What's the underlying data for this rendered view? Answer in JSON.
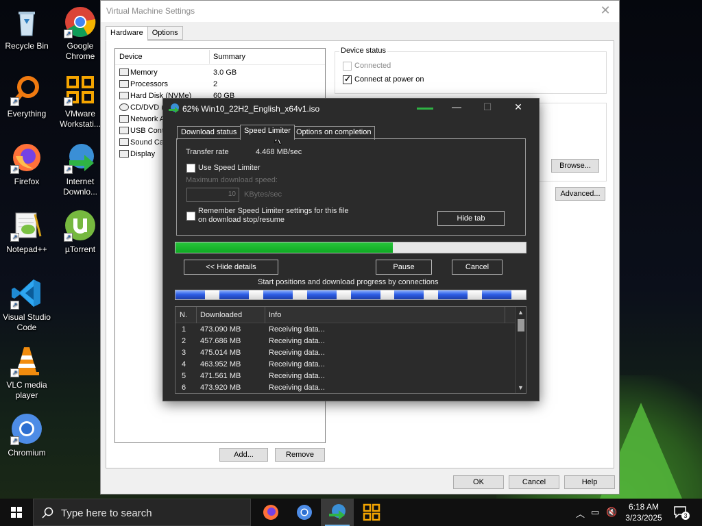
{
  "desktop": {
    "icons": [
      {
        "label": "Recycle Bin"
      },
      {
        "label": "Google Chrome"
      },
      {
        "label": "Everything"
      },
      {
        "label": "VMware Workstati..."
      },
      {
        "label": "Firefox"
      },
      {
        "label": "Internet Downlo..."
      },
      {
        "label": "Notepad++"
      },
      {
        "label": "µTorrent"
      },
      {
        "label": "Visual Studio Code"
      },
      {
        "label": "VLC media player"
      },
      {
        "label": "Chromium"
      }
    ]
  },
  "vm_settings": {
    "title": "Virtual Machine Settings",
    "close_glyph": "✕",
    "tabs": [
      {
        "label": "Hardware"
      },
      {
        "label": "Options"
      }
    ],
    "device_list": {
      "col_device": "Device",
      "col_summary": "Summary",
      "rows": [
        {
          "name": "Memory",
          "summary": "3.0 GB"
        },
        {
          "name": "Processors",
          "summary": "2"
        },
        {
          "name": "Hard Disk (NVMe)",
          "summary": "60 GB"
        },
        {
          "name": "CD/DVD (S",
          "summary": ""
        },
        {
          "name": "Network A",
          "summary": ""
        },
        {
          "name": "USB Contr",
          "summary": ""
        },
        {
          "name": "Sound Car",
          "summary": ""
        },
        {
          "name": "Display",
          "summary": ""
        }
      ]
    },
    "add_label": "Add...",
    "remove_label": "Remove",
    "device_status": {
      "title": "Device status",
      "connected_label": "Connected",
      "connected_checked": false,
      "connect_power_label": "Connect at power on",
      "connect_power_checked": true
    },
    "browse_label": "Browse...",
    "advanced_label": "Advanced...",
    "ok_label": "OK",
    "cancel_label": "Cancel",
    "help_label": "Help"
  },
  "idm": {
    "title": "62% Win10_22H2_English_x64v1.iso",
    "progress_fraction": 0.62,
    "tabs": [
      {
        "label": "Download status"
      },
      {
        "label": "Speed Limiter"
      },
      {
        "label": "Options on completion"
      }
    ],
    "transfer_rate_label": "Transfer rate",
    "transfer_rate_value": "4.468  MB/sec",
    "use_speed_limiter_label": "Use Speed Limiter",
    "max_speed_label": "Maximum download speed:",
    "max_speed_value": "10",
    "max_speed_unit": "KBytes/sec",
    "remember_label_1": "Remember Speed Limiter settings for this file",
    "remember_label_2": "on download stop/resume",
    "hide_tab_label": "Hide tab",
    "hide_details_label": "<< Hide details",
    "pause_label": "Pause",
    "cancel_label": "Cancel",
    "connections_caption": "Start positions and download progress by connections",
    "connections_segments": 8,
    "table": {
      "col_n": "N.",
      "col_downloaded": "Downloaded",
      "col_info": "Info",
      "rows": [
        {
          "n": "1",
          "downloaded": "473.090  MB",
          "info": "Receiving data..."
        },
        {
          "n": "2",
          "downloaded": "457.686  MB",
          "info": "Receiving data..."
        },
        {
          "n": "3",
          "downloaded": "475.014  MB",
          "info": "Receiving data..."
        },
        {
          "n": "4",
          "downloaded": "463.952  MB",
          "info": "Receiving data..."
        },
        {
          "n": "5",
          "downloaded": "471.561  MB",
          "info": "Receiving data..."
        },
        {
          "n": "6",
          "downloaded": "473.920  MB",
          "info": "Receiving data..."
        }
      ]
    }
  },
  "taskbar": {
    "search_placeholder": "Type here to search",
    "time": "6:18 AM",
    "date": "3/23/2025",
    "notification_count": "3"
  }
}
